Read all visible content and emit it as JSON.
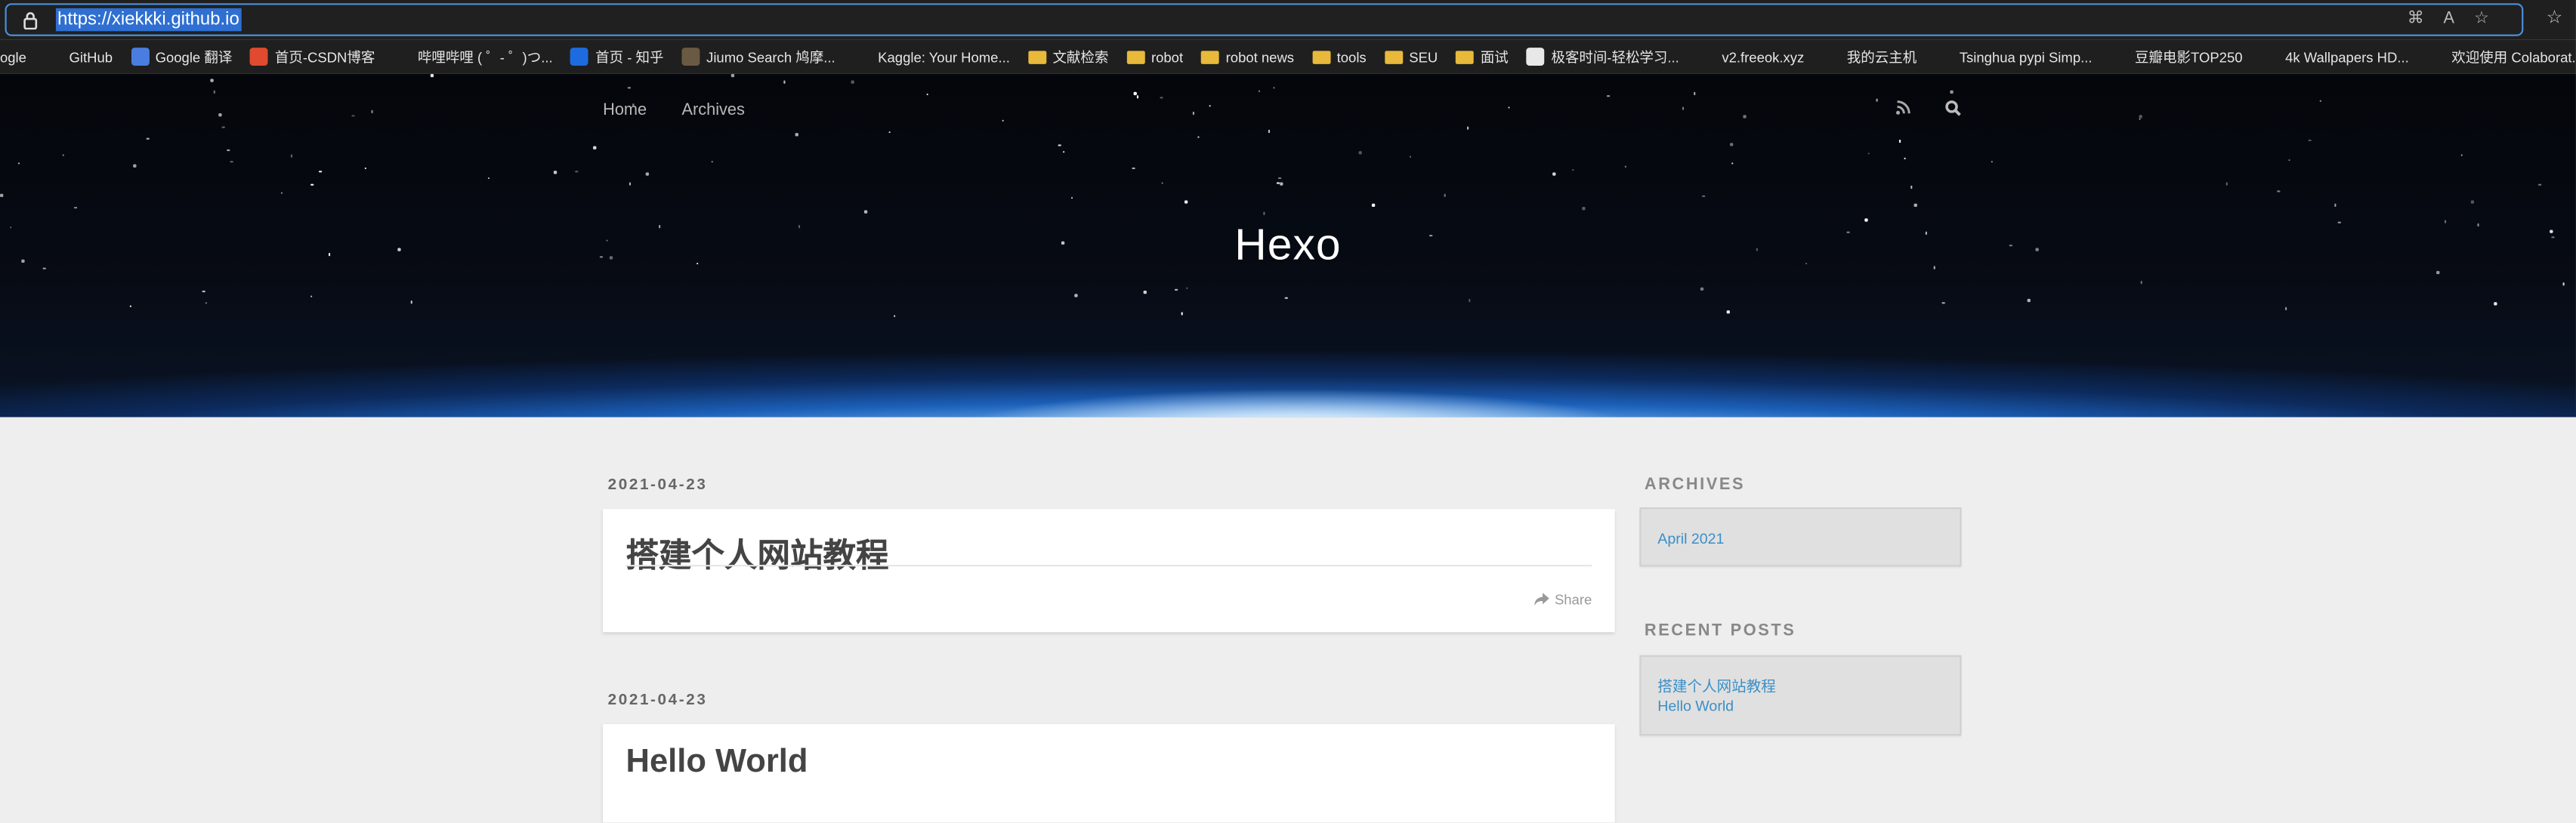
{
  "browser": {
    "url": "https://xiekkki.github.io",
    "bookmarks": [
      {
        "label": "ogle",
        "icon": "google-icon",
        "color": "#1f1f1f"
      },
      {
        "label": "GitHub",
        "icon": "github-icon",
        "color": "#1f1f1f"
      },
      {
        "label": "Google 翻译",
        "icon": "google-translate-icon",
        "color": "#4a7de0"
      },
      {
        "label": "首页-CSDN博客",
        "icon": "csdn-icon",
        "color": "#e04a2e"
      },
      {
        "label": "哔哩哔哩 ( ゜- ゜)つ...",
        "icon": "bilibili-icon",
        "color": "#1f1f1f"
      },
      {
        "label": "首页 - 知乎",
        "icon": "zhihu-icon",
        "color": "#1e6be0"
      },
      {
        "label": "Jiumo Search 鸠摩...",
        "icon": "jiumo-icon",
        "color": "#6b5a43"
      },
      {
        "label": "Kaggle: Your Home...",
        "icon": "kaggle-icon",
        "color": "#1f1f1f"
      },
      {
        "label": "文献检索",
        "icon": "folder-icon",
        "color": "#e8b93a"
      },
      {
        "label": "robot",
        "icon": "folder-icon",
        "color": "#e8b93a"
      },
      {
        "label": "robot news",
        "icon": "folder-icon",
        "color": "#e8b93a"
      },
      {
        "label": "tools",
        "icon": "folder-icon",
        "color": "#e8b93a"
      },
      {
        "label": "SEU",
        "icon": "folder-icon",
        "color": "#e8b93a"
      },
      {
        "label": "面试",
        "icon": "folder-icon",
        "color": "#e8b93a"
      },
      {
        "label": "极客时间-轻松学习...",
        "icon": "geektime-icon",
        "color": "#e8e8e8"
      },
      {
        "label": "v2.freeok.xyz",
        "icon": "freeok-icon",
        "color": "#1f1f1f"
      },
      {
        "label": "我的云主机",
        "icon": "cloud-host-icon",
        "color": "#1f1f1f"
      },
      {
        "label": "Tsinghua pypi Simp...",
        "icon": "page-icon",
        "color": "#1f1f1f"
      },
      {
        "label": "豆瓣电影TOP250",
        "icon": "douban-icon",
        "color": "#1f1f1f"
      },
      {
        "label": "4k Wallpapers HD...",
        "icon": "wallpaper-icon",
        "color": "#1f1f1f"
      },
      {
        "label": "欢迎使用 Colaborat...",
        "icon": "colab-icon",
        "color": "#1f1f1f"
      }
    ]
  },
  "header": {
    "nav": [
      "Home",
      "Archives"
    ],
    "title": "Hexo"
  },
  "posts": [
    {
      "date": "2021-04-23",
      "title": "搭建个人网站教程",
      "share": "Share"
    },
    {
      "date": "2021-04-23",
      "title": "Hello World"
    }
  ],
  "sidebar": {
    "archives_title": "ARCHIVES",
    "archives": [
      "April 2021"
    ],
    "recent_title": "RECENT POSTS",
    "recent": [
      "搭建个人网站教程",
      "Hello World"
    ]
  }
}
